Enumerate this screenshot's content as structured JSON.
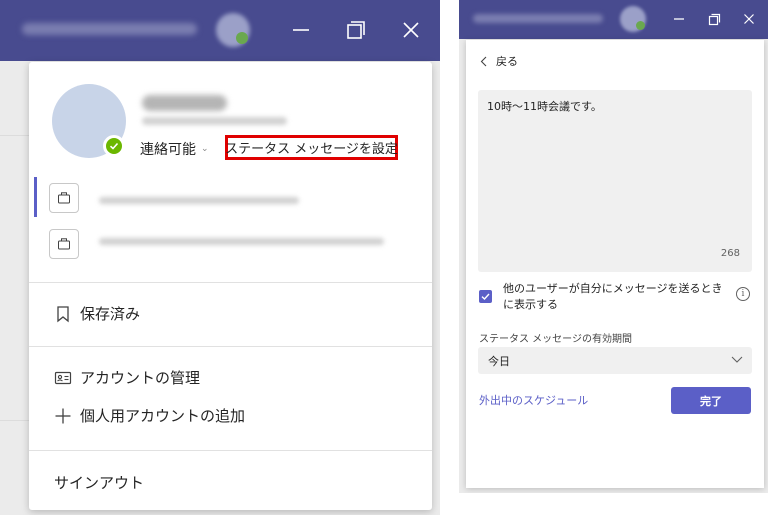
{
  "left_panel": {
    "profile": {
      "status_label": "連絡可能",
      "set_status_message_label": "ステータス メッセージを設定"
    },
    "menu": {
      "saved_label": "保存済み",
      "manage_account_label": "アカウントの管理",
      "add_personal_account_label": "個人用アカウントの追加",
      "sign_out_label": "サインアウト"
    }
  },
  "right_panel": {
    "back_label": "戻る",
    "message_text": "10時～11時会議です。",
    "char_count": "268",
    "show_when_messaging_label": "他のユーザーが自分にメッセージを送るときに表示する",
    "show_when_messaging_checked": true,
    "expiry_label": "ステータス メッセージの有効期間",
    "expiry_value": "今日",
    "schedule_link": "外出中のスケジュール",
    "done_label": "完了"
  },
  "colors": {
    "titlebar": "#484b8f",
    "accent": "#5b5fc7",
    "presence_available": "#6bb700",
    "highlight_box": "#e00000"
  }
}
